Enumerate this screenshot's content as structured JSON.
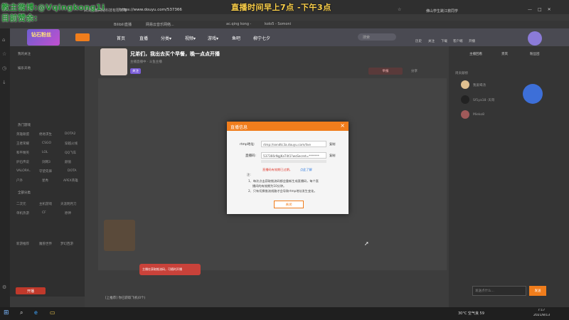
{
  "overlay": {
    "line1": "教主微博:@Vqingkong1i",
    "line2": "目前赞余:",
    "schedule": "直播时间早上7点 -下午3点"
  },
  "browser": {
    "site_name": "武汉斗鱼网络科技有限公司",
    "url": "https://www.douyu.com/537366",
    "search_text": "佛山学生跳江救同学",
    "bookmarks": [
      "Bilibili直播",
      "网易云音乐网络...",
      "ac.qing kong -",
      "kolo5 - Somoni"
    ]
  },
  "site": {
    "nav": [
      "首页",
      "直播",
      "分类▾",
      "视频▾",
      "游戏▾",
      "鱼吧",
      "柳宁七夕"
    ],
    "search_placeholder": "搜索",
    "user_actions": [
      "历史",
      "关注",
      "下载",
      "客户端",
      "开播"
    ],
    "badge": "钻石粉丝"
  },
  "room": {
    "title": "兄弟们，我出去买个早餐，晚一点点开播",
    "meta": "主播直播中 · 斗鱼主播",
    "follow": "关注",
    "share": "分享",
    "report": "举报"
  },
  "sidebar": {
    "sections": [
      "我的关注",
      "娱乐天地",
      "热门游戏",
      "全部分类"
    ],
    "items": [
      "英雄联盟",
      "绝地求生",
      "DOTA2",
      "王者荣耀",
      "CSGO",
      "穿越火线",
      "和平精英",
      "LOL",
      "QQ飞车",
      "炉石传说",
      "剑网3",
      "颜值",
      "VALORA..",
      "守望先锋",
      "DOTA",
      "户外",
      "星秀",
      "APEX英雄",
      "二次元",
      "主机游戏",
      "天涯明月刀",
      "单机热游",
      "CF",
      "原神",
      "新游推荐",
      "魔兽世界",
      "梦幻西游"
    ],
    "open_live": "开播"
  },
  "modal": {
    "title": "直播信息",
    "close": "×",
    "rtmp_label": "rtmp地址:",
    "rtmp_value": "rtmp://sendtc3a.douyu.com/live",
    "stream_label": "直播码:",
    "stream_value": "537366rNgjKaT4t1?wsSecret=*******",
    "copy": "复制",
    "warning": "直播码有效期已过期，",
    "warning_link": "点此了解",
    "note_title": "注:",
    "note_1": "1、每次点击获取推流码都会重新生成直播码，每个直",
    "note_1b": "播间的有效期为10分钟。",
    "note_2": "2、只有切换推流线路才会导致rtmp地址发生变化。",
    "close_button": "关闭"
  },
  "stage": {
    "tip": "主播在获取推流码，可随时开播",
    "bottom_left": "[上推荐] 你已获取飞机(0个)"
  },
  "right": {
    "tabs": [
      "主播回看",
      "贵宾",
      "粉丝团"
    ],
    "rank_title": "周贡献榜",
    "users": [
      "我爱喝汤",
      "Sf1ya18 ·天哥",
      "Mieko8"
    ],
    "chat_placeholder": "发送点什么...",
    "send": "发送"
  },
  "taskbar": {
    "weather": "30°C 空气良 59",
    "time": "7:17",
    "date": "2021/8/13"
  },
  "colors": {
    "orange": "#f07d1c",
    "link": "#2f7be0",
    "warning": "#e03a2d",
    "overlay_text": "#1e8a2e",
    "schedule": "#ffd24a"
  }
}
